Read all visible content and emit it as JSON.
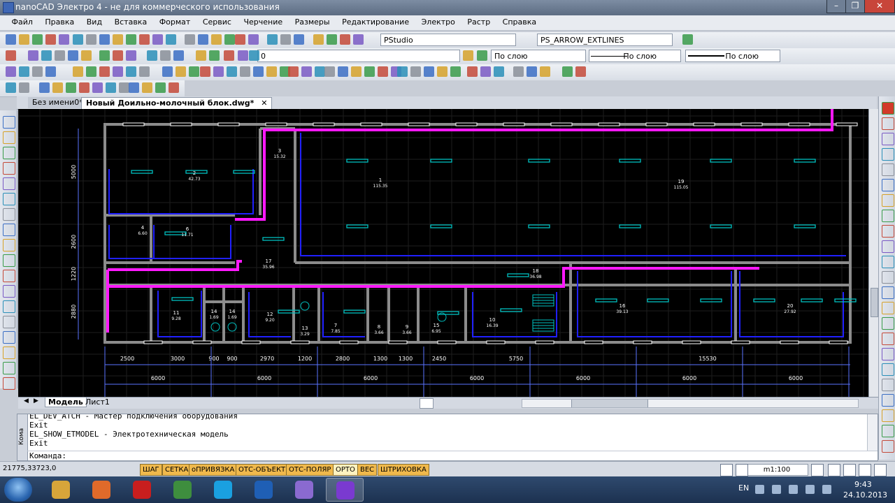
{
  "window": {
    "title": "nanoCAD Электро 4 - не для коммерческого использования",
    "minimize": "–",
    "restore": "❐",
    "close": "✕"
  },
  "menu": [
    "Файл",
    "Правка",
    "Вид",
    "Вставка",
    "Формат",
    "Сервис",
    "Черчение",
    "Размеры",
    "Редактирование",
    "Электро",
    "Растр",
    "Справка"
  ],
  "toolbar": {
    "style_combo": "PStudio",
    "dimstyle_combo": "PS_ARROW_EXTLINES",
    "layer_combo": "0",
    "color_combo": "По слою",
    "linetype_combo": "По слою",
    "lineweight_combo": "По слою"
  },
  "doc_tabs": [
    "Без имени0*",
    "Новый Доильно-молочный блок.dwg*"
  ],
  "doc_tab_close": "✕",
  "layout_tabs": [
    "Модель",
    "Лист1"
  ],
  "drawing": {
    "colors": {
      "wall": "#8c8c8c",
      "cable_main": "#ff19ff",
      "cable_blue": "#2020ff",
      "dims": "#5a73ff",
      "fixture": "#00c0c0",
      "text": "#ffffff",
      "grid": "#1e1e1e"
    },
    "rooms": [
      {
        "num": "1",
        "area": "115.35"
      },
      {
        "num": "2",
        "area": "42.73"
      },
      {
        "num": "3",
        "area": "15.32"
      },
      {
        "num": "4",
        "area": "6.60"
      },
      {
        "num": "5",
        "area": ""
      },
      {
        "num": "6",
        "area": "11.71"
      },
      {
        "num": "7",
        "area": "7.85"
      },
      {
        "num": "8",
        "area": "3.66"
      },
      {
        "num": "9",
        "area": "3.66"
      },
      {
        "num": "10",
        "area": "16.39"
      },
      {
        "num": "11",
        "area": "9.28"
      },
      {
        "num": "12",
        "area": "9.20"
      },
      {
        "num": "13",
        "area": "3.29"
      },
      {
        "num": "14",
        "area": "1.69"
      },
      {
        "num": "14",
        "area": "1.69"
      },
      {
        "num": "15",
        "area": "6.95"
      },
      {
        "num": "16",
        "area": "39.13"
      },
      {
        "num": "17",
        "area": "35.96"
      },
      {
        "num": "18",
        "area": "36.98"
      },
      {
        "num": "19",
        "area": "115.05"
      },
      {
        "num": "20",
        "area": "27.92"
      }
    ],
    "dims_vertical": [
      "5000",
      "2600",
      "1220",
      "2880"
    ],
    "dims_row1": [
      "2500",
      "3000",
      "900",
      "900",
      "2970",
      "1200",
      "2800",
      "1300",
      "1300",
      "2450",
      "5750",
      "15530"
    ],
    "dims_row2": [
      "6000",
      "6000",
      "6000",
      "6000",
      "6000",
      "6000",
      "6000"
    ]
  },
  "command": {
    "lines": [
      "EL_DEV_ATCH - Мастер подключения оборудования",
      "Exit",
      "EL_SHOW_ETMODEL - Электротехническая модель",
      "Exit"
    ],
    "prompt": "Команда:",
    "side_label": "Кома"
  },
  "status": {
    "coords": "21775,33723,0",
    "toggles": [
      {
        "label": "ШАГ",
        "on": false
      },
      {
        "label": "СЕТКА",
        "on": false
      },
      {
        "label": "оПРИВЯЗКА",
        "on": false
      },
      {
        "label": "ОТС-ОБЪЕКТ",
        "on": false
      },
      {
        "label": "ОТС-ПОЛЯР",
        "on": false
      },
      {
        "label": "ОРТО",
        "on": true
      },
      {
        "label": "ВЕС",
        "on": false
      },
      {
        "label": "ШТРИХОВКА",
        "on": false
      }
    ],
    "scale": "m1:100"
  },
  "taskbar": {
    "start": "Start",
    "apps": [
      "explorer",
      "media-player",
      "opera",
      "chrome",
      "skype",
      "outlook",
      "paint",
      "nanocad"
    ],
    "lang": "EN",
    "time": "9:43",
    "date": "24.10.2013"
  }
}
